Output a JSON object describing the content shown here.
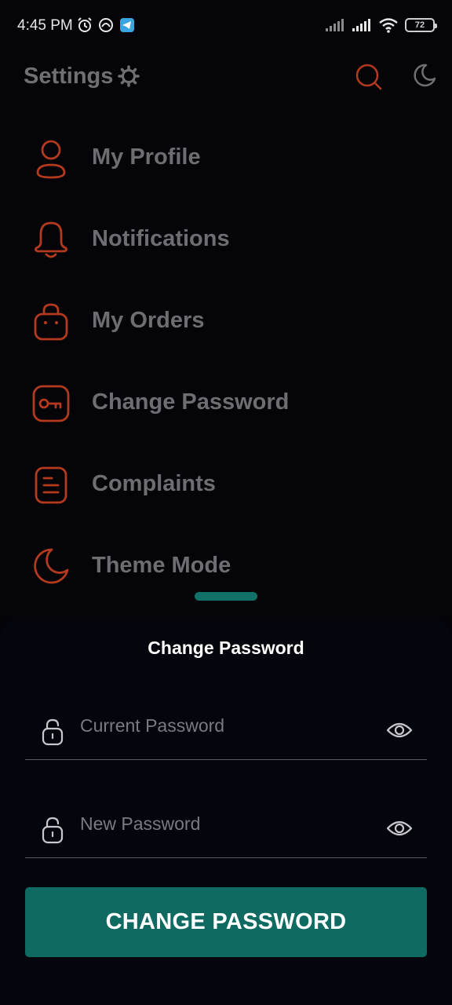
{
  "status_bar": {
    "time": "4:45 PM",
    "battery": "72",
    "icons": [
      "alarm-icon",
      "app-icon",
      "telegram-icon",
      "signal-icon",
      "signal-icon",
      "wifi-icon",
      "battery-icon"
    ]
  },
  "header": {
    "title": "Settings",
    "icons": [
      "gear-icon",
      "search-icon",
      "moon-icon"
    ]
  },
  "menu": {
    "items": [
      {
        "label": "My Profile",
        "icon": "user-icon"
      },
      {
        "label": "Notifications",
        "icon": "bell-icon"
      },
      {
        "label": "My Orders",
        "icon": "bag-icon"
      },
      {
        "label": "Change Password",
        "icon": "key-icon"
      },
      {
        "label": "Complaints",
        "icon": "document-icon"
      },
      {
        "label": "Theme Mode",
        "icon": "moon-icon"
      }
    ]
  },
  "sheet": {
    "title": "Change Password",
    "current_password": {
      "value": "",
      "placeholder": "Current Password"
    },
    "new_password": {
      "value": "",
      "placeholder": "New Password"
    },
    "submit_label": "CHANGE PASSWORD"
  },
  "colors": {
    "accent": "#b33a1e",
    "teal": "#0f6a62",
    "background": "#030308",
    "menu_text": "#6d6d72"
  }
}
